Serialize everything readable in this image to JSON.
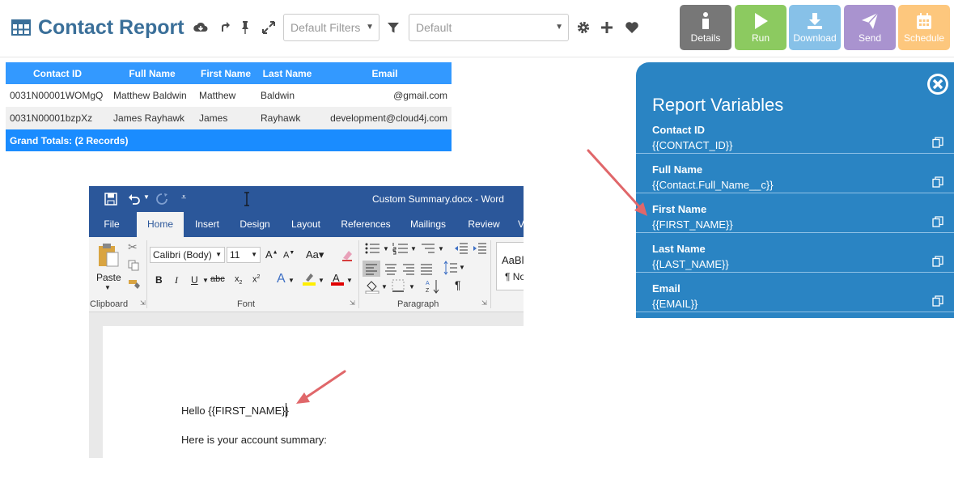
{
  "header": {
    "title": "Contact Report",
    "filter_select": "Default Filters",
    "view_select": "Default"
  },
  "actions": [
    {
      "label": "Details",
      "color": "#777777",
      "icon": "info-icon"
    },
    {
      "label": "Run",
      "color": "#8cca60",
      "icon": "play-icon"
    },
    {
      "label": "Download",
      "color": "#87c1e8",
      "icon": "download-icon"
    },
    {
      "label": "Send",
      "color": "#a993cf",
      "icon": "send-icon"
    },
    {
      "label": "Schedule",
      "color": "#fdc77d",
      "icon": "calendar-icon"
    }
  ],
  "report": {
    "columns": [
      "Contact ID",
      "Full Name",
      "First Name",
      "Last Name",
      "Email"
    ],
    "rows": [
      [
        "0031N00001WOMgQ",
        "Matthew Baldwin",
        "Matthew",
        "Baldwin",
        "@gmail.com"
      ],
      [
        "0031N00001bzpXz",
        "James Rayhawk",
        "James",
        "Rayhawk",
        "development@cloud4j.com"
      ]
    ],
    "grand_total": "Grand Totals: (2 Records)"
  },
  "word": {
    "window_title": "Custom Summary.docx  -  Word",
    "tabs": [
      "File",
      "Home",
      "Insert",
      "Design",
      "Layout",
      "References",
      "Mailings",
      "Review",
      "V"
    ],
    "font_name": "Calibri (Body)",
    "font_size": "11",
    "paste_label": "Paste",
    "groups": {
      "clipboard": "Clipboard",
      "font": "Font",
      "paragraph": "Paragraph"
    },
    "style_preview": "AaBl",
    "style_name": "¶ No",
    "doc_line1": "Hello {{FIRST_NAME}}",
    "doc_line2": "Here is your account summary:"
  },
  "variables": {
    "title": "Report Variables",
    "items": [
      {
        "label": "Contact ID",
        "value": "{{CONTACT_ID}}"
      },
      {
        "label": "Full Name",
        "value": "{{Contact.Full_Name__c}}"
      },
      {
        "label": "First Name",
        "value": "{{FIRST_NAME}}"
      },
      {
        "label": "Last Name",
        "value": "{{LAST_NAME}}"
      },
      {
        "label": "Email",
        "value": "{{EMAIL}}"
      }
    ]
  },
  "colors": {
    "brand_title": "#3a6f99",
    "table_header": "#3399ff",
    "panel_bg": "#2a84c3",
    "word_blue": "#2b579a",
    "annotation_arrow": "#e0676a"
  }
}
